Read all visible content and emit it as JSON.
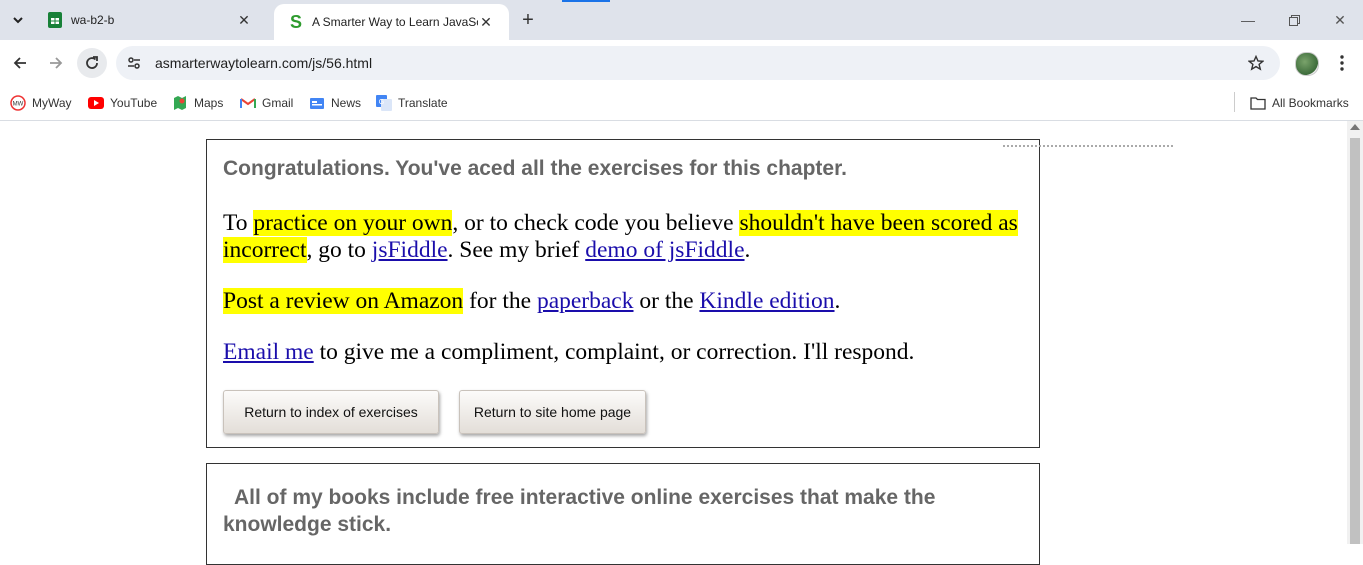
{
  "browser": {
    "tabs": [
      {
        "title": "wa-b2-b",
        "favicon": "sheets-icon"
      },
      {
        "title": "A Smarter Way to Learn JavaScript",
        "favicon": "s-logo-icon"
      }
    ],
    "url": "asmarterwaytolearn.com/js/56.html",
    "bookmarks": [
      {
        "label": "MyWay"
      },
      {
        "label": "YouTube"
      },
      {
        "label": "Maps"
      },
      {
        "label": "Gmail"
      },
      {
        "label": "News"
      },
      {
        "label": "Translate"
      }
    ],
    "all_bookmarks": "All Bookmarks"
  },
  "page": {
    "heading": "Congratulations. You've aced all the exercises for this chapter.",
    "p1": {
      "t1": "To ",
      "h1": "practice on your own",
      "t2": ", or to check code you believe ",
      "h2": "shouldn't have been scored as incorrect",
      "t3": ", go to ",
      "l1": "jsFiddle",
      "t4": ". See my brief ",
      "l2": "demo of jsFiddle",
      "t5": "."
    },
    "p2": {
      "h1": "Post a review on Amazon",
      "t1": " for the ",
      "l1": "paperback",
      "t2": " or the ",
      "l2": "Kindle edition",
      "t3": "."
    },
    "p3": {
      "l1": "Email me",
      "t1": " to give me a compliment, complaint, or correction. I'll respond."
    },
    "buttons": {
      "index": "Return to index of exercises",
      "home": "Return to site home page"
    },
    "heading2": "All of my books include free interactive online exercises that make the knowledge stick."
  }
}
